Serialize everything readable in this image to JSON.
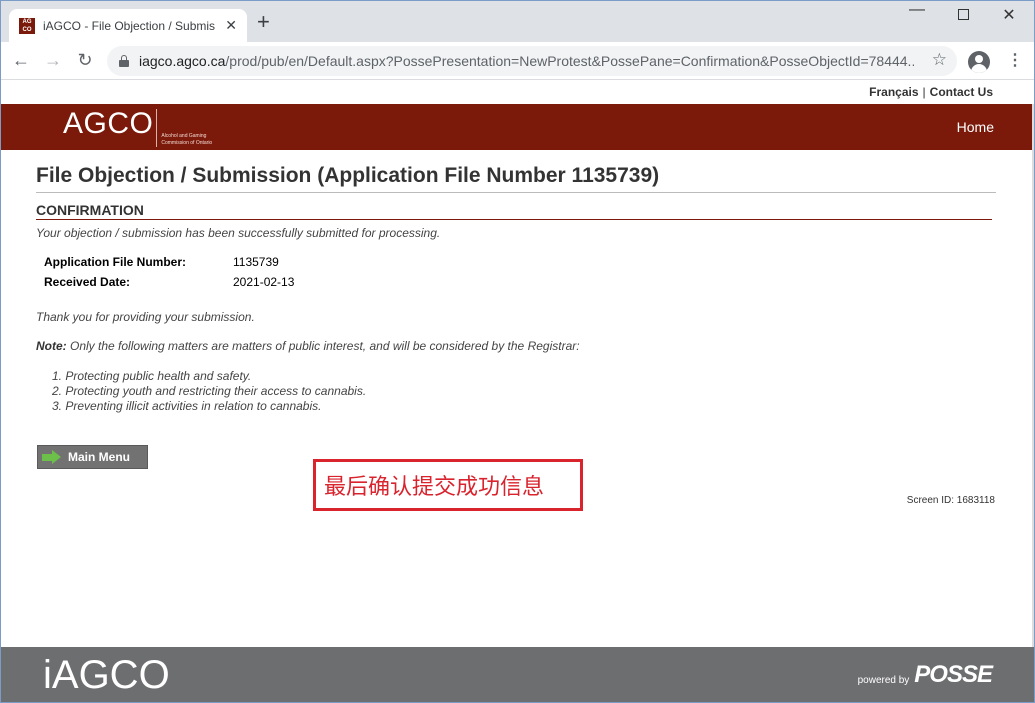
{
  "browser": {
    "tab_title": "iAGCO - File Objection / Submiss",
    "favicon_text": "AG CO",
    "url_host": "iagco.agco.ca",
    "url_path": "/prod/pub/en/Default.aspx?PossePresentation=NewProtest&PossePane=Confirmation&PosseObjectId=78444..."
  },
  "utility": {
    "francais": "Français",
    "separator": "|",
    "contact": "Contact Us"
  },
  "banner": {
    "logo": "AGCO",
    "logo_sub": "Alcohol and Gaming Commission of Ontario",
    "home": "Home"
  },
  "page": {
    "title": "File Objection / Submission (Application File Number 1135739)",
    "section": "CONFIRMATION",
    "success": "Your objection / submission has been successfully submitted for processing.",
    "details": [
      {
        "label": "Application File Number:",
        "value": "1135739"
      },
      {
        "label": "Received Date:",
        "value": "2021-02-13"
      }
    ],
    "thanks": "Thank you for providing your submission.",
    "note_label": "Note:",
    "note_text": " Only the following matters are matters of public interest, and will be considered by the Registrar:",
    "matters": [
      "1. Protecting public health and safety.",
      "2. Protecting youth and restricting their access to cannabis.",
      "3. Preventing illicit activities in relation to cannabis."
    ],
    "main_menu": "Main Menu",
    "screen_id": "Screen ID: 1683118"
  },
  "annotation": {
    "text": "最后确认提交成功信息",
    "color": "#d9232d"
  },
  "footer": {
    "logo": "iAGCO",
    "powered_by": "powered by",
    "posse": "POSSE"
  },
  "colors": {
    "brand": "#7b1a0a",
    "footer": "#6d6e70",
    "button": "#727272",
    "arrow": "#6cc04a"
  }
}
